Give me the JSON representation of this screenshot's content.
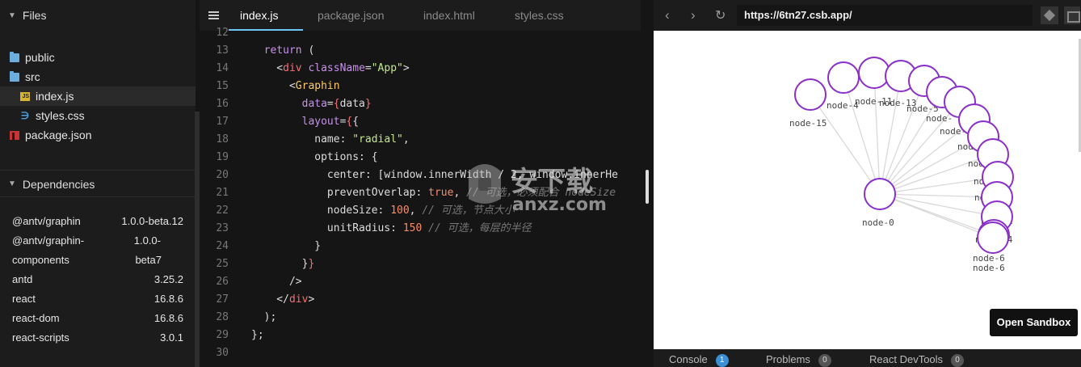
{
  "sidebar": {
    "files_title": "Files",
    "files": [
      {
        "label": "public",
        "icon": "folder-icon"
      },
      {
        "label": "src",
        "icon": "folder-icon"
      },
      {
        "label": "index.js",
        "icon": "js-file-icon"
      },
      {
        "label": "styles.css",
        "icon": "css-file-icon"
      },
      {
        "label": "package.json",
        "icon": "npm-file-icon"
      }
    ],
    "js_badge": "JS",
    "css_glyph": "∋",
    "dependencies_title": "Dependencies",
    "dependencies": [
      {
        "name": "@antv/graphin",
        "version": "1.0.0-beta.12"
      },
      {
        "name": "@antv/graphin-",
        "version": "1.0.0-"
      },
      {
        "name": "components",
        "version": "beta7"
      },
      {
        "name": "antd",
        "version": "3.25.2"
      },
      {
        "name": "react",
        "version": "16.8.6"
      },
      {
        "name": "react-dom",
        "version": "16.8.6"
      },
      {
        "name": "react-scripts",
        "version": "3.0.1"
      }
    ]
  },
  "editor": {
    "tabs": [
      "index.js",
      "package.json",
      "index.html",
      "styles.css"
    ],
    "active_tab": "index.js",
    "lines": [
      {
        "n": "12",
        "t": [
          [
            "br",
            ""
          ]
        ]
      },
      {
        "n": "13",
        "t": [
          [
            "kw",
            "  return "
          ],
          [
            "br",
            "("
          ]
        ]
      },
      {
        "n": "14",
        "t": [
          [
            "br",
            "    <"
          ],
          [
            "tg",
            "div "
          ],
          [
            "at",
            "className"
          ],
          [
            "br",
            "="
          ],
          [
            "st",
            "\"App\""
          ],
          [
            "br",
            ">"
          ]
        ]
      },
      {
        "n": "15",
        "t": [
          [
            "br",
            "      <"
          ],
          [
            "tgc",
            "Graphin"
          ]
        ]
      },
      {
        "n": "16",
        "t": [
          [
            "at",
            "        data"
          ],
          [
            "br",
            "="
          ],
          [
            "tg",
            "{"
          ],
          [
            "br",
            "data"
          ],
          [
            "tg",
            "}"
          ]
        ]
      },
      {
        "n": "17",
        "t": [
          [
            "at",
            "        layout"
          ],
          [
            "br",
            "="
          ],
          [
            "tg",
            "{"
          ],
          [
            "br",
            "{"
          ]
        ]
      },
      {
        "n": "18",
        "t": [
          [
            "br",
            "          name: "
          ],
          [
            "st",
            "\"radial\""
          ],
          [
            "br",
            ","
          ]
        ]
      },
      {
        "n": "19",
        "t": [
          [
            "br",
            "          options: {"
          ]
        ]
      },
      {
        "n": "20",
        "t": [
          [
            "br",
            "            center: [window.innerWidth / 2, window.innerHe"
          ]
        ]
      },
      {
        "n": "21",
        "t": [
          [
            "br",
            "            preventOverlap: "
          ],
          [
            "nm",
            "true"
          ],
          [
            "br",
            ", "
          ],
          [
            "cm",
            "// 可选，必须配合 nodeSize"
          ]
        ]
      },
      {
        "n": "22",
        "t": [
          [
            "br",
            "            nodeSize: "
          ],
          [
            "nm",
            "100"
          ],
          [
            "br",
            ", "
          ],
          [
            "cm",
            "// 可选，节点大小"
          ]
        ]
      },
      {
        "n": "23",
        "t": [
          [
            "br",
            "            unitRadius: "
          ],
          [
            "nm",
            "150"
          ],
          [
            "br",
            " "
          ],
          [
            "cm",
            "// 可选，每层的半径"
          ]
        ]
      },
      {
        "n": "24",
        "t": [
          [
            "br",
            "          }"
          ]
        ]
      },
      {
        "n": "25",
        "t": [
          [
            "br",
            "        }"
          ],
          [
            "tg",
            "}"
          ]
        ]
      },
      {
        "n": "26",
        "t": [
          [
            "br",
            "      />"
          ]
        ]
      },
      {
        "n": "27",
        "t": [
          [
            "br",
            "    </"
          ],
          [
            "tg",
            "div"
          ],
          [
            "br",
            ">"
          ]
        ]
      },
      {
        "n": "28",
        "t": [
          [
            "br",
            "  );"
          ]
        ]
      },
      {
        "n": "29",
        "t": [
          [
            "br",
            "};"
          ]
        ]
      },
      {
        "n": "30",
        "t": [
          [
            "br",
            ""
          ]
        ]
      }
    ]
  },
  "browser": {
    "back": "‹",
    "forward": "›",
    "reload": "↻",
    "url": "https://6tn27.csb.app/",
    "open_sandbox": "Open Sandbox",
    "console_tabs": [
      {
        "label": "Console",
        "count": "1"
      },
      {
        "label": "Problems",
        "count": "0"
      },
      {
        "label": "React DevTools",
        "count": "0"
      }
    ]
  },
  "graph": {
    "center_node": "node-0",
    "node_glyph": "",
    "node_labels": [
      "node-15",
      "node-4",
      "node-11",
      "node-13",
      "node-5",
      "node-",
      "node-10",
      "node-",
      "node-12",
      "node-7",
      "node-3",
      "node-2",
      "node-14",
      "node-6"
    ],
    "node_color": "#8b2fc9",
    "edge_color": "#d9d9d9"
  },
  "watermark": {
    "text": "安下载",
    "subtext": "anxz.com"
  }
}
